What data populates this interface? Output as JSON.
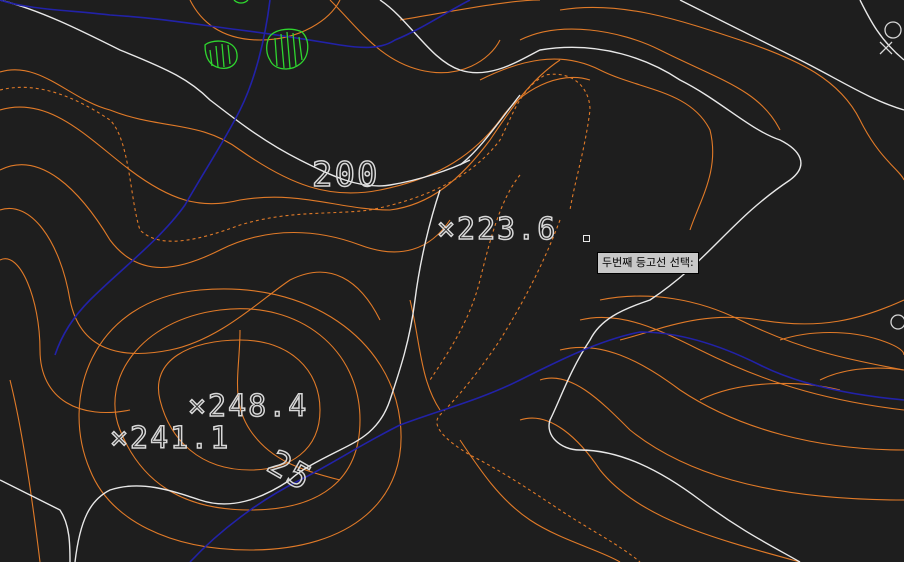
{
  "map": {
    "background": "#1e1e1e",
    "colors": {
      "major_contour": "#e8e8e8",
      "minor_contour": "#e07a28",
      "stream": "#2222a8",
      "vegetation": "#2fd62f"
    },
    "contour_labels": [
      "200",
      "25"
    ],
    "spot_heights": [
      "×223.6",
      "×248.4",
      "×241.1"
    ]
  },
  "prompt": {
    "tooltip_text": "두번째 등고선 선택:"
  }
}
